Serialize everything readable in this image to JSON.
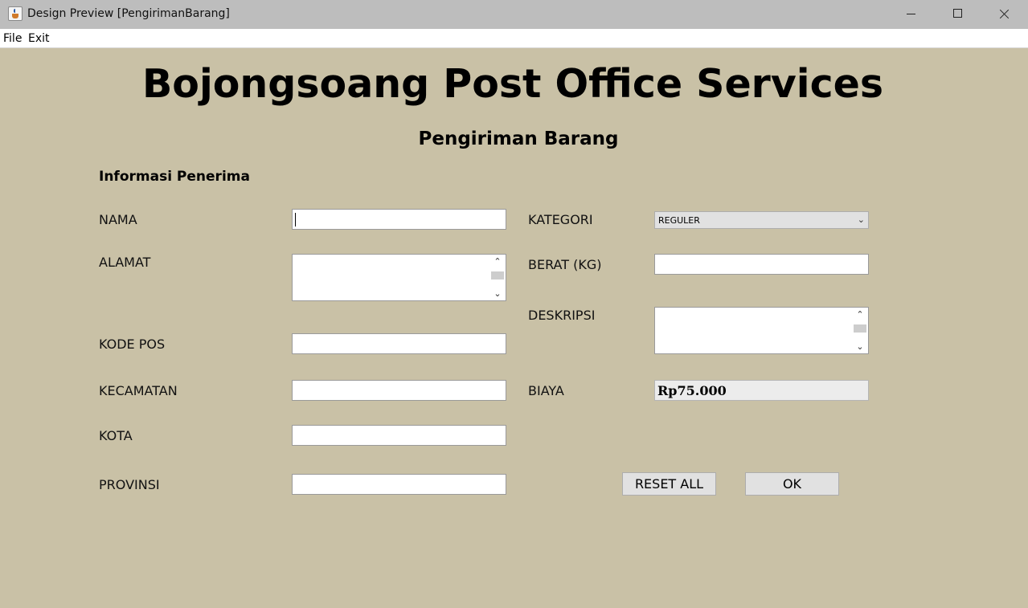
{
  "window": {
    "title": "Design Preview [PengirimanBarang]",
    "icon": "java-cup-icon",
    "controls": [
      "minimize-icon",
      "maximize-icon",
      "close-icon"
    ]
  },
  "menu": {
    "file": "File",
    "exit": "Exit"
  },
  "header": {
    "title": "Bojongsoang Post Office Services",
    "subtitle": "Pengiriman Barang"
  },
  "recipient": {
    "section_title": "Informasi Penerima",
    "nama_label": "NAMA",
    "nama_value": "",
    "alamat_label": "ALAMAT",
    "alamat_value": "",
    "kodepos_label": "KODE POS",
    "kodepos_value": "",
    "kecamatan_label": "KECAMATAN",
    "kecamatan_value": "",
    "kota_label": "KOTA",
    "kota_value": "",
    "provinsi_label": "PROVINSI",
    "provinsi_value": ""
  },
  "package": {
    "kategori_label": "KATEGORI",
    "kategori_selected": "REGULER",
    "berat_label": "BERAT (KG)",
    "berat_value": "",
    "deskripsi_label": "DESKRIPSI",
    "deskripsi_value": "",
    "biaya_label": "BIAYA",
    "biaya_value": "Rp75.000"
  },
  "buttons": {
    "reset": "RESET ALL",
    "ok": "OK"
  },
  "colors": {
    "background": "#c9c1a6",
    "titlebar": "#bdbdbd",
    "button": "#e1e1e1"
  }
}
